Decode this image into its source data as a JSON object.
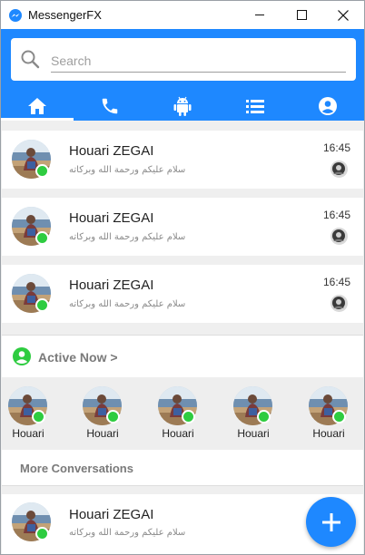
{
  "window": {
    "title": "MessengerFX",
    "icons": {
      "app": "messenger-icon",
      "minimize": "minimize-icon",
      "maximize": "maximize-icon",
      "close": "close-icon"
    }
  },
  "search": {
    "placeholder": "Search",
    "value": "",
    "icon": "search-icon"
  },
  "tabs": [
    {
      "name": "home",
      "icon": "home-icon",
      "active": true
    },
    {
      "name": "calls",
      "icon": "phone-icon",
      "active": false
    },
    {
      "name": "android",
      "icon": "android-icon",
      "active": false
    },
    {
      "name": "list",
      "icon": "list-icon",
      "active": false
    },
    {
      "name": "account",
      "icon": "account-icon",
      "active": false
    }
  ],
  "conversations": [
    {
      "name": "Houari ZEGAI",
      "message": "سلام عليكم ورحمة الله وبركاته",
      "time": "16:45",
      "online": true
    },
    {
      "name": "Houari ZEGAI",
      "message": "سلام عليكم ورحمة الله وبركاته",
      "time": "16:45",
      "online": true
    },
    {
      "name": "Houari ZEGAI",
      "message": "سلام عليكم ورحمة الله وبركاته",
      "time": "16:45",
      "online": true
    }
  ],
  "active_now": {
    "label": "Active Now >",
    "icon": "account-circle-icon",
    "users": [
      {
        "name": "Houari",
        "online": true
      },
      {
        "name": "Houari",
        "online": true
      },
      {
        "name": "Houari",
        "online": true
      },
      {
        "name": "Houari",
        "online": true
      },
      {
        "name": "Houari",
        "online": true
      }
    ]
  },
  "more_conversations": {
    "label": "More Conversations",
    "items": [
      {
        "name": "Houari ZEGAI",
        "message": "سلام عليكم ورحمة الله وبركاته",
        "online": true
      }
    ]
  },
  "fab": {
    "icon": "plus-icon"
  },
  "colors": {
    "accent": "#1e88ff",
    "online": "#2ecc40",
    "background": "#efefef"
  }
}
